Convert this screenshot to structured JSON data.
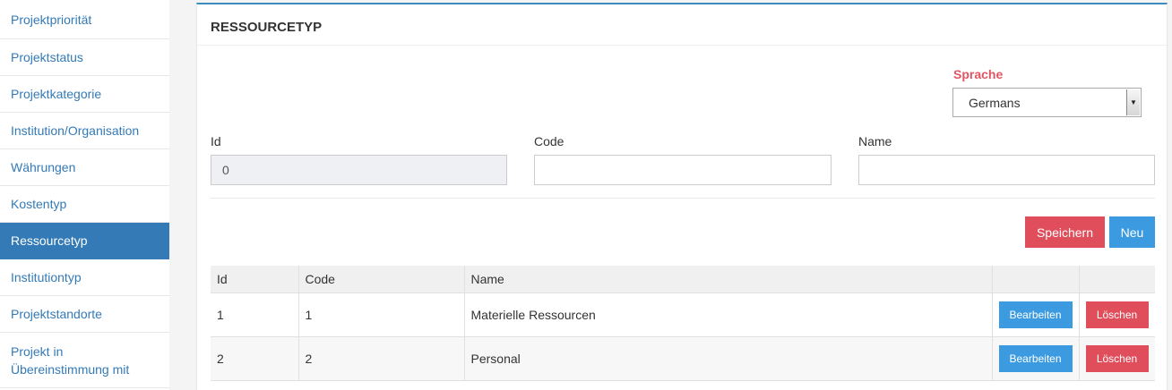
{
  "sidebar": {
    "items": [
      {
        "label": "Projektpriorität"
      },
      {
        "label": "Projektstatus"
      },
      {
        "label": "Projektkategorie"
      },
      {
        "label": "Institution/Organisation"
      },
      {
        "label": "Währungen"
      },
      {
        "label": "Kostentyp"
      },
      {
        "label": "Ressourcetyp",
        "active": true
      },
      {
        "label": "Institutiontyp"
      },
      {
        "label": "Projektstandorte"
      },
      {
        "label": "Projekt in Übereinstimmung mit"
      }
    ]
  },
  "panel": {
    "title": "RESSOURCETYP",
    "language": {
      "label": "Sprache",
      "selected": "Germans"
    },
    "form": {
      "id_label": "Id",
      "id_value": "0",
      "code_label": "Code",
      "code_value": "",
      "name_label": "Name",
      "name_value": ""
    },
    "buttons": {
      "save": "Speichern",
      "new": "Neu"
    },
    "table": {
      "headers": [
        "Id",
        "Code",
        "Name",
        "",
        ""
      ],
      "rows": [
        {
          "id": "1",
          "code": "1",
          "name": "Materielle Ressourcen",
          "edit": "Bearbeiten",
          "delete": "Löschen"
        },
        {
          "id": "2",
          "code": "2",
          "name": "Personal",
          "edit": "Bearbeiten",
          "delete": "Löschen"
        }
      ]
    }
  },
  "colors": {
    "accent": "#337ab7",
    "danger": "#e04e5c",
    "primary": "#3c9be0",
    "label_red": "#e05563"
  }
}
